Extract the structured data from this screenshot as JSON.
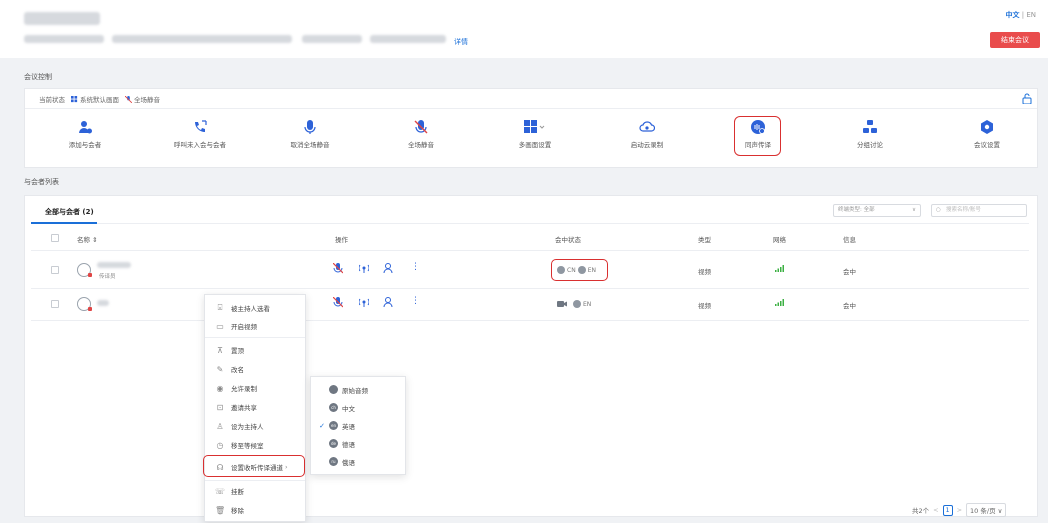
{
  "header": {
    "lang_zh": "中文",
    "lang_sep": "|",
    "lang_en": "EN",
    "detail_link": "详情",
    "end_button": "结束会议"
  },
  "control": {
    "section_title": "会议控制",
    "status_label": "当前状态",
    "status_layout": "系统默认画面",
    "status_mute": "全场静音",
    "tools": [
      {
        "label": "添加与会者",
        "icon": "add-user-icon"
      },
      {
        "label": "呼叫未入会与会者",
        "icon": "phone-call-icon"
      },
      {
        "label": "取消全场静音",
        "icon": "microphone-icon"
      },
      {
        "label": "全场静音",
        "icon": "microphone-muted-icon"
      },
      {
        "label": "多画面设置",
        "icon": "multi-screen-icon"
      },
      {
        "label": "启动云录制",
        "icon": "cloud-record-icon"
      },
      {
        "label": "同声传译",
        "icon": "interpretation-icon"
      },
      {
        "label": "分组讨论",
        "icon": "breakout-icon"
      },
      {
        "label": "会议设置",
        "icon": "settings-icon"
      }
    ]
  },
  "participants": {
    "section_title": "与会者列表",
    "tab_label": "全部与会者 (2)",
    "filter_label": "终端类型: 全部",
    "search_placeholder": "搜索名称/账号",
    "columns": [
      "名称 ⇕",
      "操作",
      "会中状态",
      "类型",
      "网络",
      "信息"
    ],
    "rows": [
      {
        "role": "传译员",
        "lang1": "CN",
        "lang2": "EN",
        "type": "视频",
        "info": "会中"
      },
      {
        "role": "",
        "lang1": "",
        "lang2": "EN",
        "type": "视频",
        "info": "会中"
      }
    ],
    "pager": {
      "total": "共2个",
      "prev": "<",
      "page": "1",
      "next": ">",
      "size": "10 条/页 ∨"
    }
  },
  "context_menu": {
    "items": [
      {
        "label": "被主持人选看",
        "icon": "watch-icon"
      },
      {
        "label": "开启视频",
        "icon": "video-icon"
      },
      {
        "label": "置顶",
        "icon": "pin-top-icon"
      },
      {
        "label": "改名",
        "icon": "edit-icon"
      },
      {
        "label": "允许录制",
        "icon": "record-icon"
      },
      {
        "label": "邀请共享",
        "icon": "share-icon"
      },
      {
        "label": "设为主持人",
        "icon": "host-icon"
      },
      {
        "label": "移至等候室",
        "icon": "waiting-room-icon"
      },
      {
        "label": "设置收听传译通道",
        "icon": "listen-channel-icon"
      },
      {
        "label": "挂断",
        "icon": "hangup-icon"
      },
      {
        "label": "移除",
        "icon": "trash-icon"
      }
    ]
  },
  "submenu": {
    "items": [
      {
        "label": "原始音频",
        "badge": "",
        "checked": false
      },
      {
        "label": "中文",
        "badge": "ch",
        "checked": false
      },
      {
        "label": "英语",
        "badge": "en",
        "checked": true
      },
      {
        "label": "德语",
        "badge": "de",
        "checked": false
      },
      {
        "label": "俄语",
        "badge": "ru",
        "checked": false
      }
    ]
  },
  "colors": {
    "accent": "#1a6fd8",
    "danger": "#e94c4c",
    "highlight": "#d93030"
  }
}
